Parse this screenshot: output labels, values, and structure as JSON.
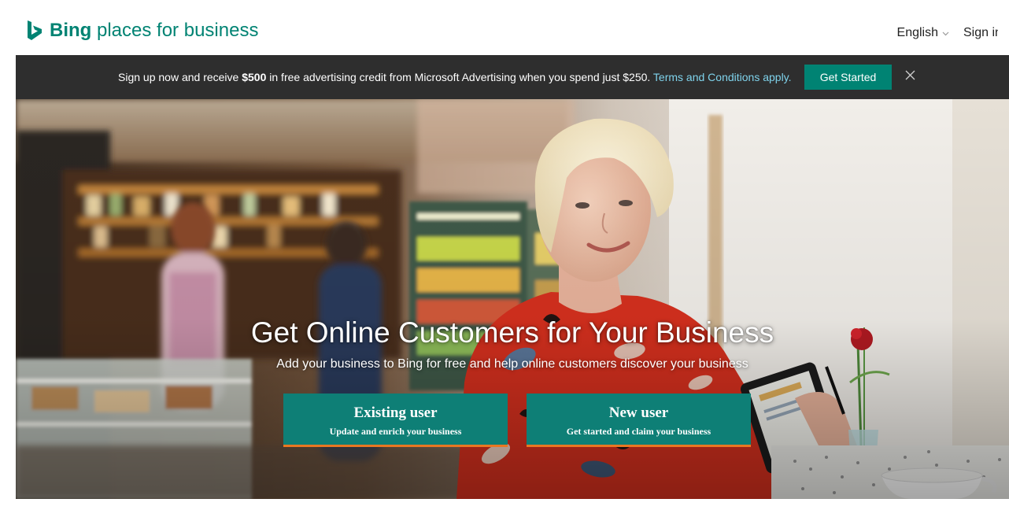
{
  "header": {
    "logo_brand": "Bing",
    "logo_suffix": " places for business",
    "language_label": "English",
    "signin_label": "Sign in"
  },
  "banner": {
    "text_before": "Sign up now and receive ",
    "text_amount": "$500",
    "text_after": " in free advertising credit from Microsoft Advertising when you spend just $250. ",
    "terms_link": "Terms and Conditions apply.",
    "cta_label": "Get Started"
  },
  "hero": {
    "title": "Get Online Customers for Your Business",
    "subtitle": "Add your business to Bing for free and help online customers discover your business",
    "buttons": [
      {
        "title": "Existing user",
        "subtitle": "Update and enrich your business"
      },
      {
        "title": "New user",
        "subtitle": "Get started and claim your business"
      }
    ]
  },
  "colors": {
    "brand_teal": "#008373",
    "banner_bg": "#2e2e2e",
    "link_blue": "#7fd3ec",
    "cta_bg": "#0e7f76",
    "cta_accent": "#e87722"
  },
  "icons": {
    "logo": "bing-logo-icon",
    "language_chevron": "chevron-down-icon",
    "banner_close": "close-icon"
  }
}
